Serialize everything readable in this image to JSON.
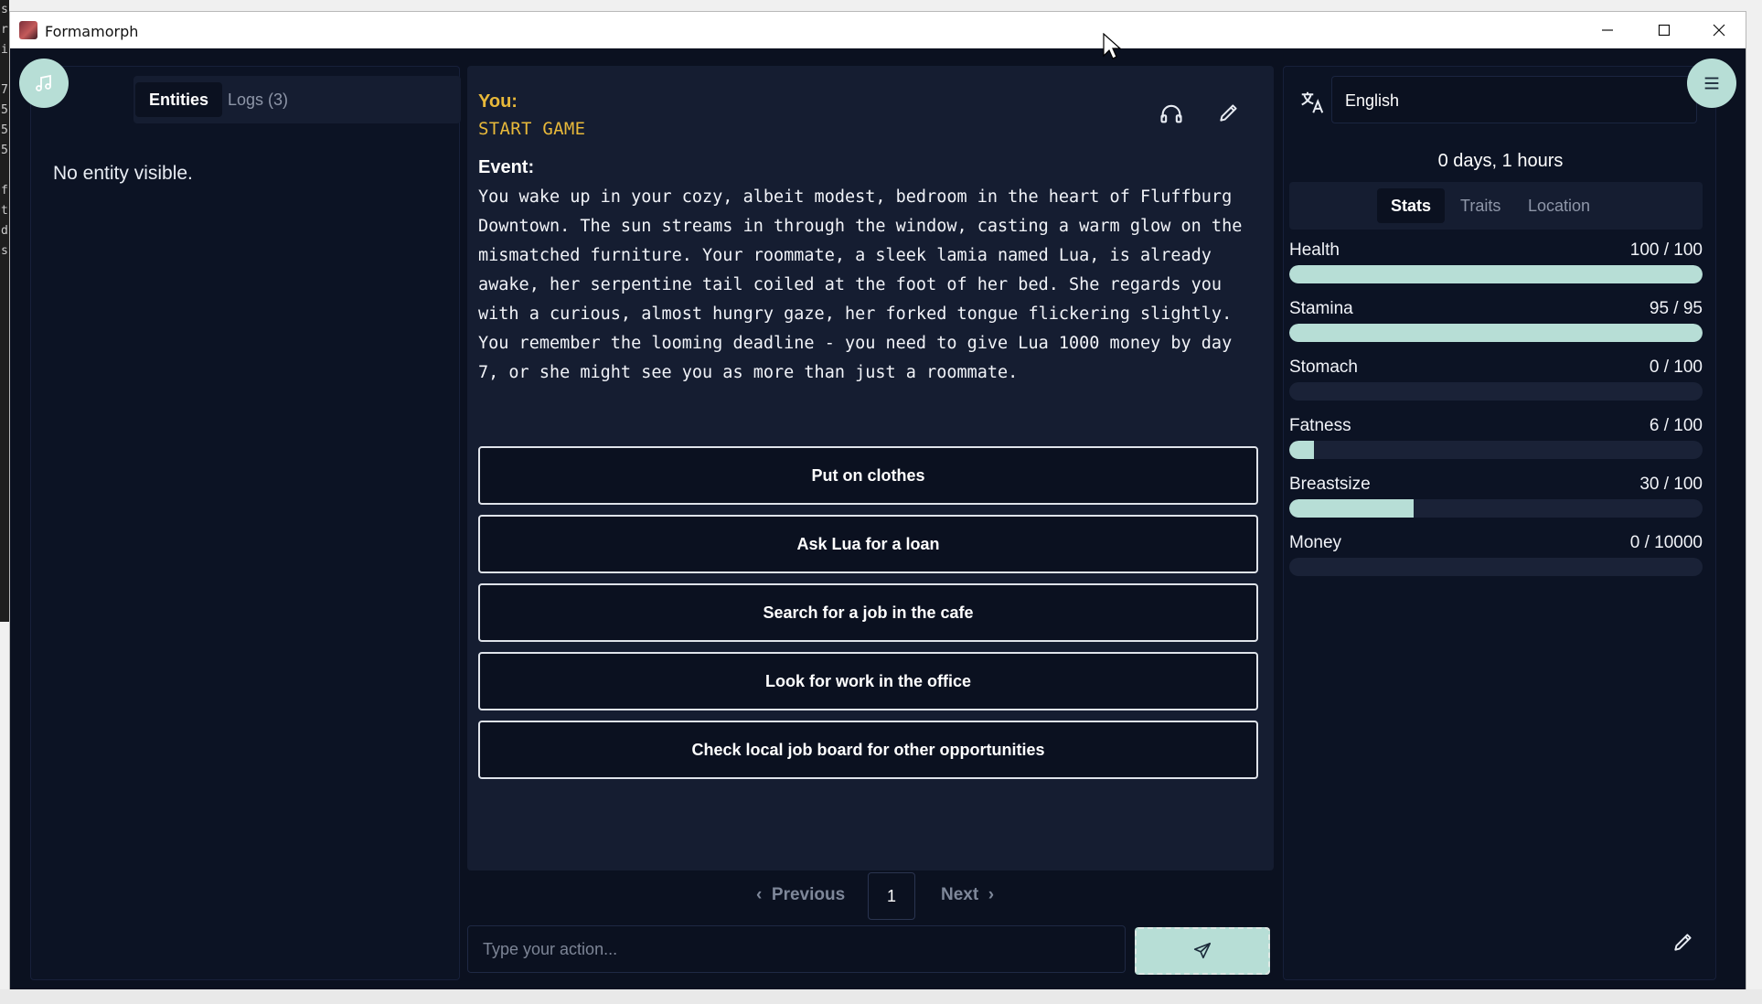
{
  "window": {
    "title": "Formamorph"
  },
  "left": {
    "tabs": [
      {
        "label": "Entities",
        "active": true
      },
      {
        "label": "Logs (3)",
        "active": false
      }
    ],
    "empty_text": "No entity visible."
  },
  "story": {
    "you_label": "You:",
    "you_text": "START GAME",
    "event_label": "Event:",
    "event_text": "You wake up in your cozy, albeit modest, bedroom in the heart of Fluffburg Downtown. The sun streams in through the window, casting a warm glow on the mismatched furniture. Your roommate, a sleek lamia named Lua, is already awake, her serpentine tail coiled at the foot of her bed. She regards you with a curious, almost hungry gaze, her forked tongue flickering slightly. You remember the looming deadline - you need to give Lua 1000 money by day 7, or she might see you as more than just a roommate.",
    "choices": [
      "Put on clothes",
      "Ask Lua for a loan",
      "Search for a job in the cafe",
      "Look for work in the office",
      "Check local job board for other opportunities"
    ]
  },
  "pager": {
    "prev": "Previous",
    "page": "1",
    "next": "Next"
  },
  "action": {
    "placeholder": "Type your action..."
  },
  "right": {
    "language": "English",
    "time": "0 days, 1 hours",
    "tabs": [
      {
        "label": "Stats",
        "active": true
      },
      {
        "label": "Traits",
        "active": false
      },
      {
        "label": "Location",
        "active": false
      }
    ],
    "stats": [
      {
        "name": "Health",
        "value": "100 / 100",
        "fraction": 1.0
      },
      {
        "name": "Stamina",
        "value": "95 / 95",
        "fraction": 1.0
      },
      {
        "name": "Stomach",
        "value": "0 / 100",
        "fraction": 0.0
      },
      {
        "name": "Fatness",
        "value": "6 / 100",
        "fraction": 0.06
      },
      {
        "name": "Breastsize",
        "value": "30 / 100",
        "fraction": 0.3
      },
      {
        "name": "Money",
        "value": "0 / 10000",
        "fraction": 0.0
      }
    ]
  },
  "colors": {
    "accent": "#b7ded6",
    "you": "#e8b93a",
    "background": "#0b1120"
  },
  "icons": [
    "music-icon",
    "headphones-icon",
    "pencil-icon",
    "translate-icon",
    "menu-icon",
    "send-icon",
    "chevron-left-icon",
    "chevron-right-icon"
  ]
}
